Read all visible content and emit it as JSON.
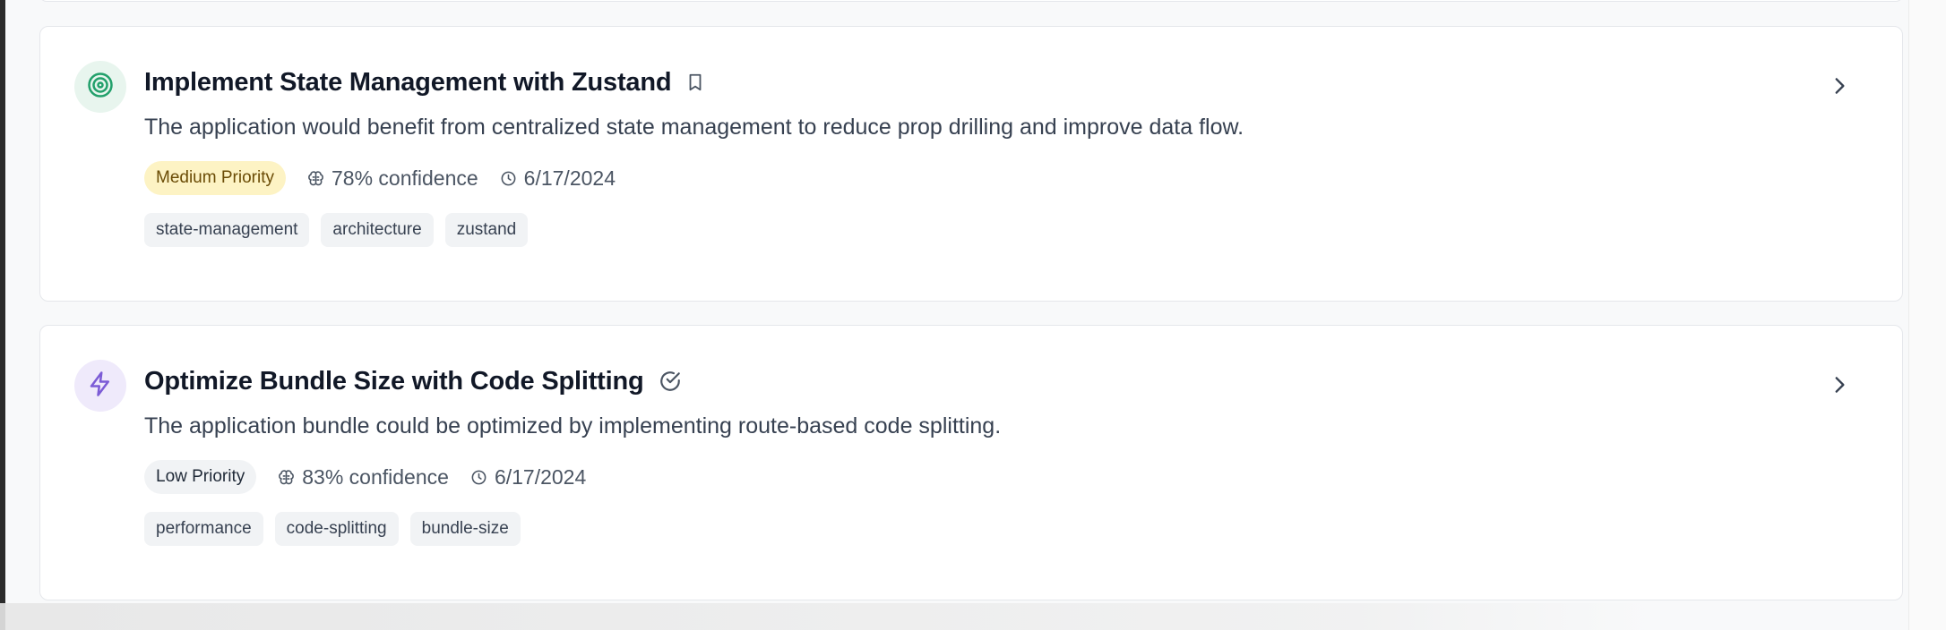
{
  "colors": {
    "accent_green": "#22a06b",
    "green_bg": "#e8f5ee",
    "accent_purple": "#7c5cd6",
    "purple_bg": "#efeafb",
    "medium_priority_bg": "#fdf3c4",
    "medium_priority_text": "#6b4c06",
    "low_priority_bg": "#f1f3f5",
    "low_priority_text": "#1f2937"
  },
  "insights": [
    {
      "icon": "target-icon",
      "title": "Implement State Management with Zustand",
      "status_icon": "bookmark-icon",
      "description": "The application would benefit from centralized state management to reduce prop drilling and improve data flow.",
      "priority": "Medium Priority",
      "confidence": "78% confidence",
      "date": "6/17/2024",
      "tags": [
        "state-management",
        "architecture",
        "zustand"
      ]
    },
    {
      "icon": "lightning-icon",
      "title": "Optimize Bundle Size with Code Splitting",
      "status_icon": "check-circle-icon",
      "description": "The application bundle could be optimized by implementing route-based code splitting.",
      "priority": "Low Priority",
      "confidence": "83% confidence",
      "date": "6/17/2024",
      "tags": [
        "performance",
        "code-splitting",
        "bundle-size"
      ]
    }
  ]
}
